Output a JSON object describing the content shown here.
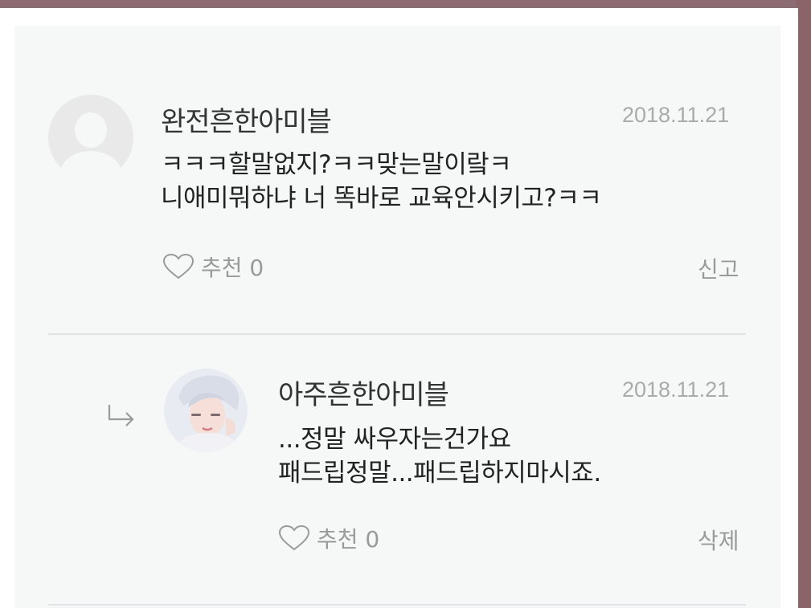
{
  "comments": [
    {
      "username": "완전흔한아미블",
      "date": "2018.11.21",
      "lines": [
        "ㅋㅋㅋ할말없지?ㅋㅋ맞는말이랔ㅋ",
        "니애미뭐하냐 너 똑바로 교육안시키고?ㅋㅋ"
      ],
      "like_label": "추천 0",
      "action_label": "신고",
      "avatar_icon": "default-user-icon"
    },
    {
      "username": "아주흔한아미블",
      "date": "2018.11.21",
      "lines": [
        "...정말 싸우자는건가요",
        "패드립정말...패드립하지마시죠."
      ],
      "like_label": "추천 0",
      "action_label": "삭제",
      "avatar_icon": "profile-photo",
      "is_reply": true
    }
  ],
  "colors": {
    "card_bg": "#f6f7f7",
    "text": "#222222",
    "muted": "#9a9a9a",
    "divider": "#e1e3e4",
    "frame": "#8e6870"
  },
  "icons": {
    "like": "heart-outline-icon",
    "reply": "reply-arrow-icon"
  }
}
